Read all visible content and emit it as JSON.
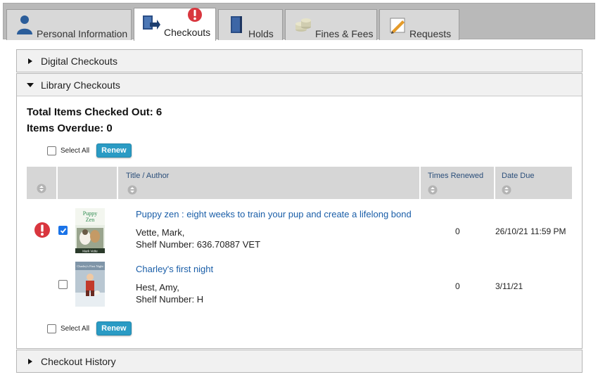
{
  "tabs": [
    {
      "label": "Personal Information"
    },
    {
      "label": "Checkouts"
    },
    {
      "label": "Holds"
    },
    {
      "label": "Fines & Fees"
    },
    {
      "label": "Requests"
    }
  ],
  "sections": {
    "digital": "Digital Checkouts",
    "library": "Library Checkouts",
    "history": "Checkout History"
  },
  "summary": {
    "total": "Total Items Checked Out: 6",
    "overdue": "Items Overdue: 0"
  },
  "controls": {
    "select_all": "Select All",
    "renew": "Renew"
  },
  "table": {
    "headers": [
      "Title / Author",
      "Times Renewed",
      "Date Due"
    ]
  },
  "items": [
    {
      "title": "Puppy zen : eight weeks to train your pup and create a lifelong bond",
      "author": "Vette, Mark,",
      "shelf": "Shelf Number: 636.70887 VET",
      "times_renewed": "0",
      "date_due": "26/10/21 11:59 PM",
      "checked": true,
      "alert": true,
      "cover_text": "Puppy Zen",
      "cover_author": "Mark Vette"
    },
    {
      "title": "Charley's first night",
      "author": "Hest, Amy,",
      "shelf": "Shelf Number: H",
      "times_renewed": "0",
      "date_due": "3/11/21",
      "checked": false,
      "alert": false,
      "cover_text": "Charley's First Night"
    }
  ],
  "colors": {
    "link": "#1a5ea8",
    "button": "#2a9bc4",
    "alert": "#d9363e",
    "header_bg": "#d6d6d6"
  }
}
